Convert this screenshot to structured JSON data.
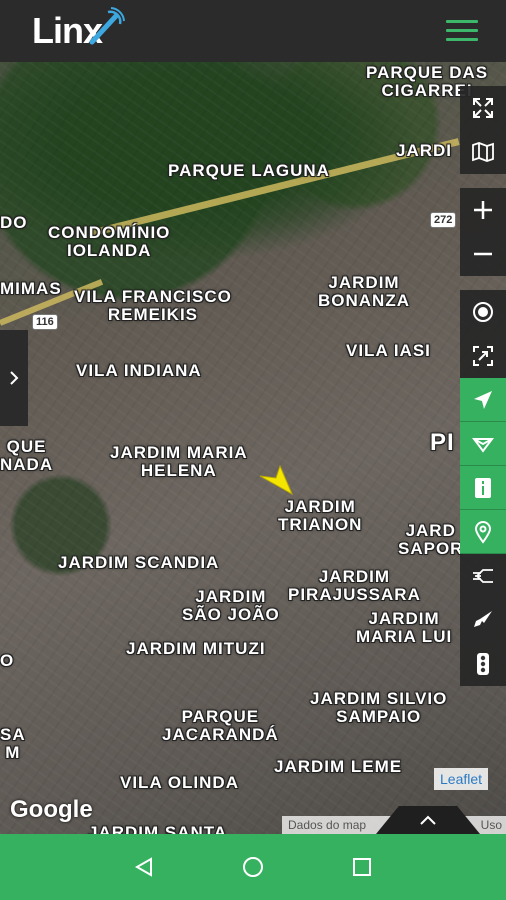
{
  "app": {
    "logo_text": "Linx"
  },
  "colors": {
    "accent": "#35b15f",
    "topbar": "#2b2b2b",
    "marker": "#f5e600"
  },
  "map": {
    "labels": [
      {
        "text": "PARQUE DAS\nCIGARREI"
      },
      {
        "text": "JARDI"
      },
      {
        "text": "PARQUE LAGUNA"
      },
      {
        "text": "DO"
      },
      {
        "text": "CONDOMÍNIO\nIOLANDA"
      },
      {
        "text": "MIMAS"
      },
      {
        "text": "VILA FRANCISCO\nREMEIKIS"
      },
      {
        "text": "JARDIM\nBONANZA"
      },
      {
        "text": "VILA IASI"
      },
      {
        "text": "VILA INDIANA"
      },
      {
        "text": "QUE\nNADA"
      },
      {
        "text": "JARDIM MARIA\nHELENA"
      },
      {
        "text": "PI"
      },
      {
        "text": "JARDIM\nTRIANON"
      },
      {
        "text": "JARD\nSAPOR"
      },
      {
        "text": "JARDIM SCANDIA"
      },
      {
        "text": "JARDIM\nPIRAJUSSARA"
      },
      {
        "text": "JARDIM\nSÃO JOÃO"
      },
      {
        "text": "JARDIM\nMARIA LUI"
      },
      {
        "text": "JARDIM MITUZI"
      },
      {
        "text": "O"
      },
      {
        "text": "JARDIM SILVIO\nSAMPAIO"
      },
      {
        "text": "PARQUE\nJACARANDÁ"
      },
      {
        "text": "SA\nM"
      },
      {
        "text": "JARDIM LEME"
      },
      {
        "text": "VILA OLINDA"
      },
      {
        "text": "JARDIM SANTA"
      }
    ],
    "shields": [
      "272",
      "116"
    ],
    "google_logo": "Google",
    "leaflet_link": "Leaflet",
    "attribution_start": "Dados do map",
    "attribution_end": "Uso"
  },
  "right_toolbar": [
    {
      "icon": "fullscreen-icon",
      "style": "dark"
    },
    {
      "icon": "map-layers-icon",
      "style": "dark"
    },
    {
      "icon": "zoom-in-icon",
      "style": "dark"
    },
    {
      "icon": "zoom-out-icon",
      "style": "dark"
    },
    {
      "icon": "target-icon",
      "style": "dark"
    },
    {
      "icon": "fit-bounds-icon",
      "style": "dark"
    },
    {
      "icon": "navigation-arrow-icon",
      "style": "green"
    },
    {
      "icon": "route-filter-icon",
      "style": "green"
    },
    {
      "icon": "info-icon",
      "style": "green"
    },
    {
      "icon": "location-pin-icon",
      "style": "green"
    },
    {
      "icon": "speed-lines-icon",
      "style": "dark"
    },
    {
      "icon": "rocket-icon",
      "style": "dark"
    },
    {
      "icon": "traffic-light-icon",
      "style": "dark"
    }
  ],
  "navbar": [
    "back-icon",
    "home-icon",
    "recents-icon"
  ]
}
